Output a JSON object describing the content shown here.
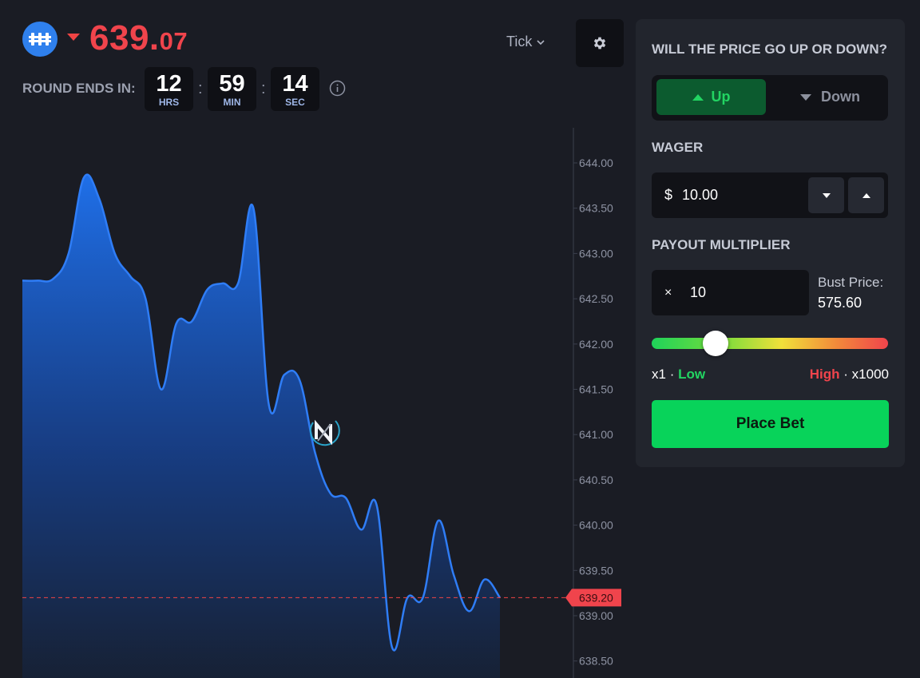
{
  "header": {
    "coin_icon": "coin-icon",
    "price_direction": "down",
    "price_whole": "639.",
    "price_decimals": "07",
    "price_color": "#f0444c",
    "interval_label": "Tick",
    "settings_icon": "gear-icon"
  },
  "round": {
    "label": "ROUND ENDS IN:",
    "hours": {
      "value": "12",
      "unit": "HRS"
    },
    "minutes": {
      "value": "59",
      "unit": "MIN"
    },
    "seconds": {
      "value": "14",
      "unit": "SEC"
    },
    "separator": ":",
    "info_icon": "info-icon"
  },
  "chart_data": {
    "type": "area",
    "y_ticks": [
      "644.00",
      "643.50",
      "643.00",
      "642.50",
      "642.00",
      "641.50",
      "641.00",
      "640.50",
      "640.00",
      "639.50",
      "639.00",
      "638.50"
    ],
    "ylim": [
      638.4,
      644.0
    ],
    "current_value": 639.2,
    "current_label": "639.20",
    "series": [
      {
        "color": "#2f7df6",
        "values": [
          642.7,
          642.7,
          642.72,
          643.0,
          643.84,
          643.6,
          643.0,
          642.75,
          642.5,
          641.5,
          642.23,
          642.25,
          642.6,
          642.67,
          642.67,
          643.5,
          641.33,
          641.66,
          641.6,
          640.8,
          640.35,
          640.3,
          639.95,
          640.22,
          638.65,
          639.2,
          639.2,
          640.05,
          639.45,
          639.05,
          639.4,
          639.2
        ]
      }
    ]
  },
  "panel": {
    "question": "WILL THE PRICE GO UP OR DOWN?",
    "up_label": "Up",
    "down_label": "Down",
    "selected": "up",
    "wager_label": "WAGER",
    "wager_currency": "$",
    "wager_value": "10.00",
    "multiplier_label": "PAYOUT MULTIPLIER",
    "multiplier_prefix": "×",
    "multiplier_value": "10",
    "bust_label": "Bust Price:",
    "bust_value": "575.60",
    "slider_fraction": 0.27,
    "range_min": "x1",
    "range_min_sep": "·",
    "range_min_label": "Low",
    "range_max_label": "High",
    "range_max_sep": "·",
    "range_max": "x1000",
    "place_bet_label": "Place Bet",
    "colors": {
      "up": "#22d462",
      "down": "#8c909d",
      "place_bet": "#08d35a"
    }
  }
}
